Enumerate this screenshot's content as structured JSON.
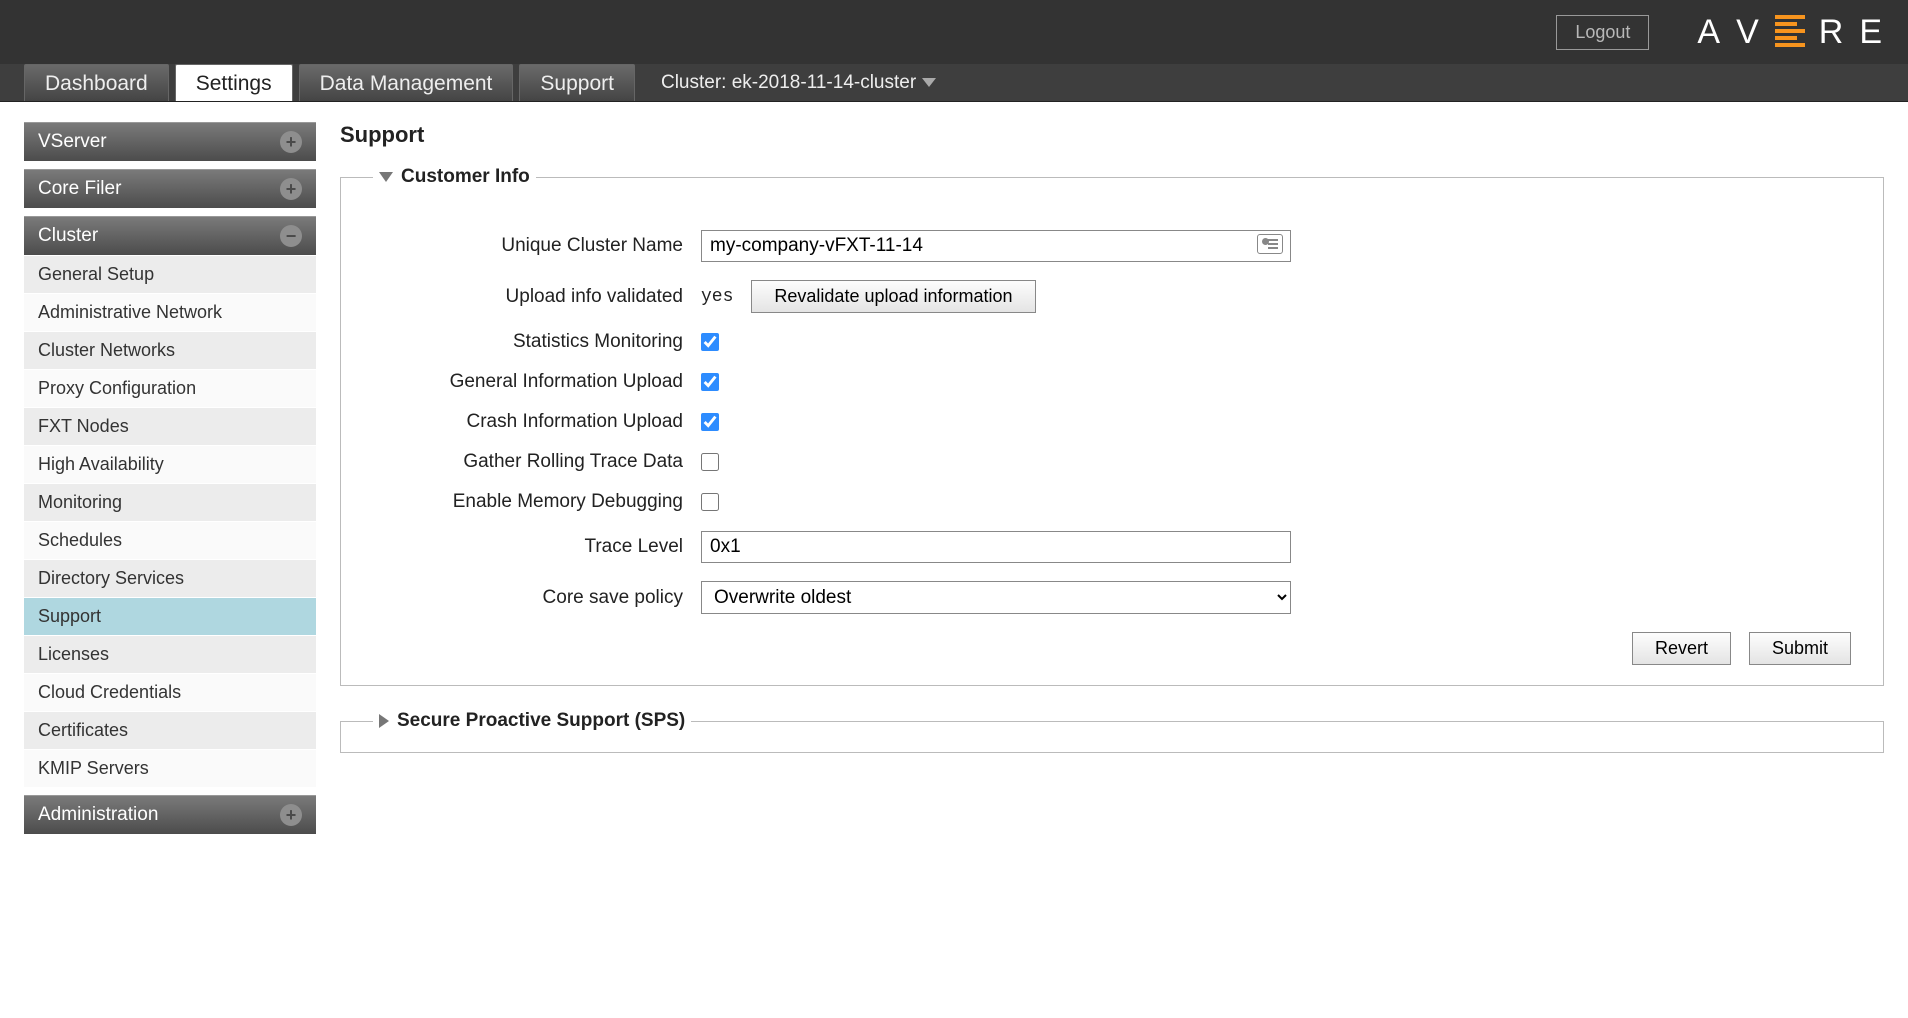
{
  "topbar": {
    "logout": "Logout"
  },
  "tabs": [
    "Dashboard",
    "Settings",
    "Data Management",
    "Support"
  ],
  "active_tab": "Settings",
  "cluster_label": "Cluster: ek-2018-11-14-cluster",
  "sidebar": {
    "sections": [
      {
        "title": "VServer",
        "expanded": false,
        "items": []
      },
      {
        "title": "Core Filer",
        "expanded": false,
        "items": []
      },
      {
        "title": "Cluster",
        "expanded": true,
        "items": [
          "General Setup",
          "Administrative Network",
          "Cluster Networks",
          "Proxy Configuration",
          "FXT Nodes",
          "High Availability",
          "Monitoring",
          "Schedules",
          "Directory Services",
          "Support",
          "Licenses",
          "Cloud Credentials",
          "Certificates",
          "KMIP Servers"
        ],
        "active_item": "Support"
      },
      {
        "title": "Administration",
        "expanded": false,
        "items": []
      }
    ]
  },
  "page": {
    "title": "Support"
  },
  "customer_info": {
    "legend": "Customer Info",
    "labels": {
      "cluster_name": "Unique Cluster Name",
      "upload_validated": "Upload info validated",
      "stats_mon": "Statistics Monitoring",
      "gen_upload": "General Information Upload",
      "crash_upload": "Crash Information Upload",
      "rolling_trace": "Gather Rolling Trace Data",
      "mem_debug": "Enable Memory Debugging",
      "trace_level": "Trace Level",
      "core_policy": "Core save policy"
    },
    "values": {
      "cluster_name": "my-company-vFXT-11-14",
      "upload_validated": "yes",
      "revalidate_btn": "Revalidate upload information",
      "stats_mon": true,
      "gen_upload": true,
      "crash_upload": true,
      "rolling_trace": false,
      "mem_debug": false,
      "trace_level": "0x1",
      "core_policy": "Overwrite oldest"
    },
    "actions": {
      "revert": "Revert",
      "submit": "Submit"
    }
  },
  "sps": {
    "legend": "Secure Proactive Support (SPS)"
  }
}
